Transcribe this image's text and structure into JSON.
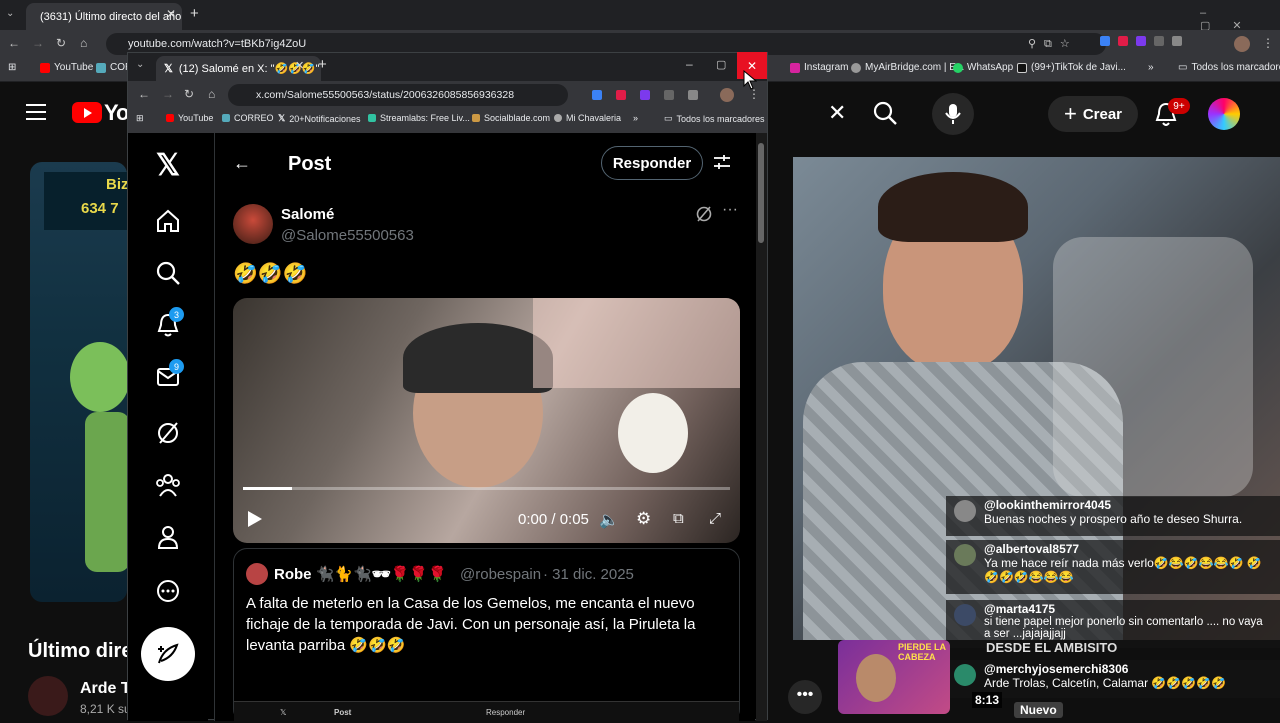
{
  "outer_browser": {
    "tab_title": "(3631) Último directo del año -",
    "url": "youtube.com/watch?v=tBKb7ig4ZoU",
    "bookmarks": [
      "YouTube",
      "CORR",
      "Instagram",
      "MyAirBridge.com | E...",
      "WhatsApp",
      "(99+)TikTok de Javi..."
    ],
    "all_bookmarks": "Todos los marcadores"
  },
  "youtube": {
    "logo_text": "You",
    "create_label": "Crear",
    "notif_badge": "9+",
    "title": "Último dire",
    "channel": "Arde T",
    "subs": "8,21 K su",
    "ad_line1": "Biz",
    "ad_line2": "634 7",
    "stream_overlay": "DESDE EL AMBISITO",
    "thumb_caption": "PIERDE LA CABEZA",
    "duration": "8:13",
    "new_label": "Nuevo",
    "chat": [
      {
        "user": "@lookinthemirror4045",
        "text": "Buenas noches y prospero año te deseo Shurra."
      },
      {
        "user": "@albertoval8577",
        "text": "Ya me hace reír nada más verlo🤣😂🤣😂😂🤣 🤣🤣🤣🤣😂😂😂"
      },
      {
        "user": "@marta4175",
        "text": "si tiene papel mejor ponerlo sin comentarlo .... no vaya a ser ...jajajajjajj"
      },
      {
        "user": "@merchyjosemerchi8306",
        "text": "Arde Trolas, Calcetín, Calamar 🤣🤣🤣🤣🤣"
      }
    ]
  },
  "front_browser": {
    "tab_title": "(12) Salomé en X: \"🤣🤣🤣\"",
    "url": "x.com/Salome55500563/status/2006326085856936328",
    "bookmarks": [
      "YouTube",
      "CORREO",
      "20+Notificaciones",
      "Streamlabs: Free Liv...",
      "Socialblade.com",
      "Mi Chavaleria"
    ],
    "all_bookmarks": "Todos los marcadores"
  },
  "x": {
    "notif_badge": "3",
    "msg_badge": "9",
    "header_title": "Post",
    "reply_label": "Responder",
    "author_name": "Salomé",
    "author_handle": "@Salome55500563",
    "post_text": "🤣🤣🤣",
    "video_time": "0:00 / 0:05",
    "video_progress": 0.1,
    "quote_name": "Robe 🐈‍⬛🐈🐈‍⬛🕶🌹🌹🌹",
    "quote_handle": "@robespain",
    "quote_date": "· 31 dic. 2025",
    "quote_text": "A falta de meterlo en la Casa de los Gemelos, me encanta el nuevo fichaje de la temporada de Javi. Con un personaje así, la Piruleta la levanta parriba 🤣🤣🤣",
    "mini_post": "Post",
    "mini_reply": "Responder"
  }
}
